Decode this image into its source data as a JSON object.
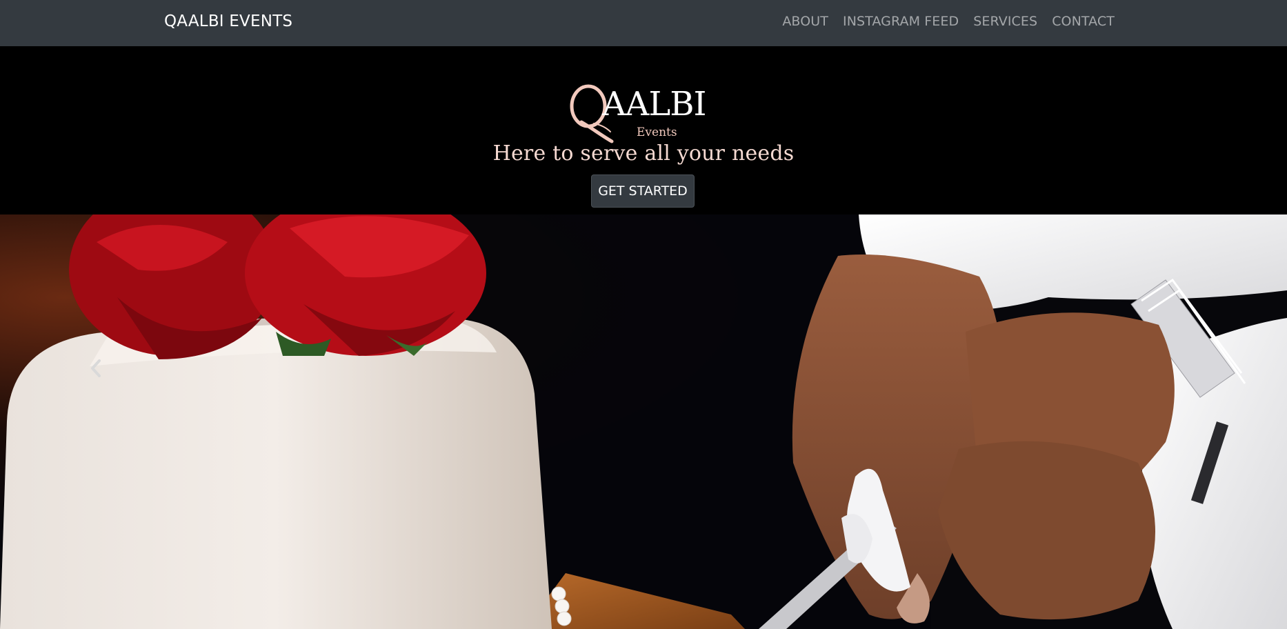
{
  "navbar": {
    "brand": "QAALBI EVENTS",
    "links": [
      "ABOUT",
      "INSTAGRAM FEED",
      "SERVICES",
      "CONTACT"
    ]
  },
  "hero": {
    "logo_main": "AALBI",
    "logo_initial": "Q",
    "logo_sub": "Events",
    "tagline": "Here to serve all your needs",
    "cta_label": "GET STARTED"
  },
  "carousel": {
    "prev_icon": "chevron-left-icon",
    "slide_image": "wedding-cake-cutting-photo"
  },
  "colors": {
    "navbar_bg": "#343a40",
    "hero_bg": "#000000",
    "tagline": "#f6dad2",
    "logo_pink": "#f2c9bd",
    "button_bg": "#343a40"
  }
}
